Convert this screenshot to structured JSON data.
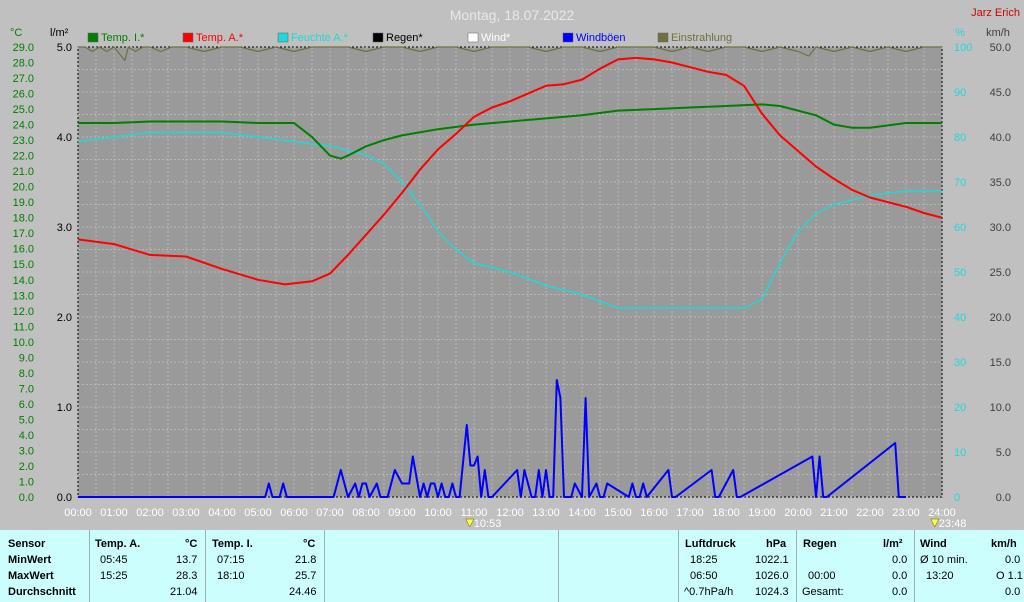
{
  "title": "Montag, 18.07.2022",
  "author": "Jarz Erich",
  "colors": {
    "temp_i": "#007f00",
    "temp_a": "#ff0000",
    "humidity": "#20d8d8",
    "rain": "#000000",
    "wind": "#ffffff",
    "gust": "#0000ff",
    "sunshine": "#707040",
    "left_axis": "#007f00",
    "mid_axis": "#000000",
    "right_axis1": "#20d8d8",
    "right_axis2": "#404040"
  },
  "chart_data": {
    "type": "line",
    "title": "Montag, 18.07.2022",
    "x_unit": "hour",
    "x_ticks": [
      "00:00",
      "01:00",
      "02:00",
      "03:00",
      "04:00",
      "05:00",
      "06:00",
      "07:00",
      "08:00",
      "09:00",
      "10:00",
      "11:00",
      "12:00",
      "13:00",
      "14:00",
      "15:00",
      "16:00",
      "17:00",
      "18:00",
      "19:00",
      "20:00",
      "21:00",
      "22:00",
      "23:00",
      "24:00"
    ],
    "axes": {
      "temp": {
        "unit": "°C",
        "min": 0,
        "max": 29,
        "ticks": [
          "0.0",
          "1.0",
          "2.0",
          "3.0",
          "4.0",
          "5.0",
          "6.0",
          "7.0",
          "8.0",
          "9.0",
          "10.0",
          "11.0",
          "12.0",
          "13.0",
          "14.0",
          "15.0",
          "16.0",
          "17.0",
          "18.0",
          "19.0",
          "20.0",
          "21.0",
          "22.0",
          "23.0",
          "24.0",
          "25.0",
          "26.0",
          "27.0",
          "28.0",
          "29.0"
        ]
      },
      "rain": {
        "unit": "l/m²",
        "min": 0,
        "max": 5,
        "ticks": [
          "0.0",
          "1.0",
          "2.0",
          "3.0",
          "4.0",
          "5.0"
        ]
      },
      "humidity": {
        "unit": "%",
        "min": 0,
        "max": 100,
        "ticks": [
          "0",
          "10",
          "20",
          "30",
          "40",
          "50",
          "60",
          "70",
          "80",
          "90",
          "100"
        ]
      },
      "wind": {
        "unit": "km/h",
        "min": 0,
        "max": 50,
        "ticks": [
          "0.0",
          "5.0",
          "10.0",
          "15.0",
          "20.0",
          "25.0",
          "30.0",
          "35.0",
          "40.0",
          "45.0",
          "50.0"
        ]
      }
    },
    "grid": true,
    "legend_position": "top",
    "series": [
      {
        "name": "Temp. I.*",
        "axis": "temp",
        "color": "#007f00",
        "x": [
          0,
          1,
          2,
          3,
          4,
          5,
          6,
          6.5,
          7,
          7.3,
          7.5,
          8,
          8.5,
          9,
          10,
          11,
          12,
          13,
          14,
          15,
          16,
          17,
          18,
          19,
          19.5,
          20,
          20.5,
          21,
          21.5,
          22,
          23,
          24
        ],
        "y": [
          24.1,
          24.1,
          24.2,
          24.2,
          24.2,
          24.1,
          24.1,
          23.2,
          22.0,
          21.8,
          22.0,
          22.6,
          23.0,
          23.3,
          23.7,
          24.0,
          24.2,
          24.4,
          24.6,
          24.9,
          25.0,
          25.1,
          25.2,
          25.3,
          25.2,
          24.9,
          24.6,
          24.0,
          23.8,
          23.8,
          24.1,
          24.1
        ]
      },
      {
        "name": "Temp. A.*",
        "axis": "temp",
        "color": "#ff0000",
        "x": [
          0,
          1,
          2,
          3,
          4,
          5,
          5.75,
          6.5,
          7,
          7.5,
          8,
          8.5,
          9,
          9.5,
          10,
          10.5,
          11,
          11.5,
          12,
          12.5,
          13,
          13.5,
          14,
          14.5,
          15,
          15.5,
          16,
          16.5,
          17,
          17.5,
          18,
          18.5,
          19,
          19.5,
          20,
          20.5,
          21,
          21.5,
          22,
          22.5,
          23,
          23.5,
          24
        ],
        "y": [
          16.6,
          16.3,
          15.6,
          15.5,
          14.7,
          14.0,
          13.7,
          13.9,
          14.4,
          15.6,
          16.9,
          18.2,
          19.6,
          21.1,
          22.4,
          23.4,
          24.5,
          25.1,
          25.5,
          26.0,
          26.5,
          26.6,
          26.9,
          27.6,
          28.2,
          28.3,
          28.2,
          28.0,
          27.7,
          27.4,
          27.2,
          26.5,
          24.7,
          23.3,
          22.3,
          21.3,
          20.5,
          19.8,
          19.3,
          19.0,
          18.7,
          18.3,
          18.0
        ]
      },
      {
        "name": "Feuchte A.*",
        "axis": "humidity",
        "color": "#20d8d8",
        "x": [
          0,
          1,
          2,
          3,
          4,
          5,
          6,
          7,
          8,
          8.5,
          9,
          9.5,
          10,
          10.5,
          11,
          12,
          13,
          14,
          15,
          16,
          17,
          18,
          18.5,
          19,
          19.5,
          20,
          20.5,
          21,
          21.5,
          22,
          23,
          24
        ],
        "y": [
          79,
          80,
          81,
          81,
          81,
          80,
          79,
          78,
          76,
          74,
          70,
          65,
          59,
          55,
          52,
          50,
          47,
          45,
          42,
          42,
          42,
          42,
          42,
          44,
          52,
          59,
          63,
          65,
          66,
          67,
          68,
          68
        ]
      },
      {
        "name": "Regen*",
        "axis": "rain",
        "color": "#000000",
        "x": [
          0,
          24
        ],
        "y": [
          0,
          0
        ]
      },
      {
        "name": "Wind*",
        "axis": "wind",
        "color": "#ffffff",
        "x": [
          0,
          24
        ],
        "y": [
          0,
          0
        ]
      },
      {
        "name": "Windböen",
        "axis": "wind",
        "color": "#0000ff",
        "x": [
          0,
          5.2,
          5.3,
          5.4,
          5.6,
          5.7,
          5.8,
          7.1,
          7.3,
          7.5,
          7.7,
          7.8,
          7.9,
          8.0,
          8.1,
          8.3,
          8.4,
          8.6,
          8.8,
          9.0,
          9.1,
          9.2,
          9.3,
          9.5,
          9.6,
          9.7,
          9.8,
          9.9,
          10.0,
          10.1,
          10.2,
          10.3,
          10.4,
          10.5,
          10.6,
          10.8,
          10.9,
          11.0,
          11.1,
          11.2,
          11.3,
          11.4,
          11.5,
          12.2,
          12.3,
          12.4,
          12.6,
          12.7,
          12.8,
          12.9,
          13.0,
          13.1,
          13.2,
          13.3,
          13.4,
          13.5,
          13.6,
          13.7,
          13.8,
          14.0,
          14.1,
          14.2,
          14.4,
          14.5,
          14.6,
          14.7,
          15.3,
          15.4,
          15.5,
          15.6,
          15.7,
          15.8,
          16.4,
          16.5,
          16.6,
          17.6,
          17.7,
          17.8,
          18.2,
          18.3,
          18.4,
          20.4,
          20.5,
          20.6,
          20.7,
          20.8,
          22.7,
          22.8,
          22.9,
          23.0
        ],
        "y": [
          0,
          0,
          1.5,
          0,
          0,
          1.5,
          0,
          0,
          3,
          0,
          1.5,
          0,
          1.5,
          1.5,
          0,
          1.5,
          0,
          0,
          3,
          1.5,
          1.5,
          1.5,
          4.5,
          0,
          1.5,
          0,
          1.5,
          1.5,
          0,
          1.5,
          0,
          0,
          1.5,
          0,
          0,
          8,
          3.5,
          3.5,
          4.5,
          0,
          3,
          0,
          0,
          3,
          0,
          3,
          0,
          0,
          3,
          0,
          3,
          0,
          0,
          13,
          11,
          0,
          0,
          0,
          1.5,
          0,
          11,
          0,
          1.5,
          0,
          0,
          1.5,
          0,
          1.5,
          0,
          0,
          1.5,
          0,
          3,
          0,
          0,
          3,
          0,
          0,
          3,
          0,
          0,
          4.5,
          0,
          4.5,
          0,
          0,
          6,
          0,
          0,
          0
        ]
      },
      {
        "name": "Einstrahlung",
        "axis": "humidity",
        "color": "#707040",
        "x": [
          0,
          0.2,
          0.4,
          0.6,
          0.8,
          1.0,
          1.2,
          1.3,
          1.4,
          1.6,
          1.8,
          2.0,
          2.3,
          2.6,
          3.0,
          3.5,
          4.0,
          4.5,
          5.0,
          5.5,
          6.0,
          6.5,
          7.0,
          7.5,
          8.0,
          8.5,
          9.0,
          9.5,
          10.0,
          10.5,
          11.0,
          11.5,
          12.0,
          12.5,
          13.0,
          13.5,
          14.0,
          14.5,
          15.0,
          15.5,
          16.0,
          16.5,
          17.0,
          17.5,
          18.0,
          18.5,
          19.0,
          19.5,
          20.0,
          20.3,
          20.5,
          21.0,
          21.5,
          22.0,
          22.5,
          23.0,
          23.5,
          24.0
        ],
        "y": [
          100,
          100,
          99,
          100,
          99,
          100,
          98,
          97,
          100,
          99,
          100,
          100,
          99,
          100,
          100,
          99,
          100,
          100,
          99,
          100,
          99,
          100,
          100,
          100,
          99,
          100,
          100,
          99,
          100,
          100,
          99,
          100,
          100,
          100,
          99,
          100,
          100,
          99,
          100,
          100,
          100,
          99,
          100,
          99,
          100,
          100,
          99,
          100,
          99,
          98,
          100,
          99,
          100,
          99,
          100,
          99,
          100,
          100
        ]
      }
    ],
    "markers": [
      {
        "label": "10:53",
        "x": 10.883
      },
      {
        "label": "23:48",
        "x": 23.8
      }
    ]
  },
  "legend_labels": [
    "Temp. I.*",
    "Temp. A.*",
    "Feuchte A.*",
    "Regen*",
    "Wind*",
    "Windböen",
    "Einstrahlung"
  ],
  "stats": {
    "sensor_header": "Sensor",
    "min_label": "MinWert",
    "max_label": "MaxWert",
    "avg_label": "Durchschnitt",
    "temp_a": {
      "header": "Temp. A.",
      "unit": "°C",
      "min_time": "05:45",
      "min": "13.7",
      "max_time": "15:25",
      "max": "28.3",
      "avg": "21.04"
    },
    "temp_i": {
      "header": "Temp. I.",
      "unit": "°C",
      "min_time": "07:15",
      "min": "21.8",
      "max_time": "18:10",
      "max": "25.7",
      "avg": "24.46"
    },
    "pressure": {
      "header": "Luftdruck",
      "unit": "hPa",
      "r1_label": "18:25",
      "r1_value": "1022.1",
      "r2_label": "06:50",
      "r2_value": "1026.0",
      "r3_label": "^0.7hPa/h",
      "r3_value": "1024.3"
    },
    "rain": {
      "header": "Regen",
      "unit": "l/m²",
      "r1_value": "0.0",
      "r2_label": "00:00",
      "r2_value": "0.0",
      "r3_label": "Gesamt:",
      "r3_value": "0.0"
    },
    "wind": {
      "header": "Wind",
      "unit": "km/h",
      "r1_label": "Ø 10 min.",
      "r1_value": "0.0",
      "r2_label": "13:20",
      "r2_value": "O 1.1",
      "r3_value": "0.0"
    }
  }
}
